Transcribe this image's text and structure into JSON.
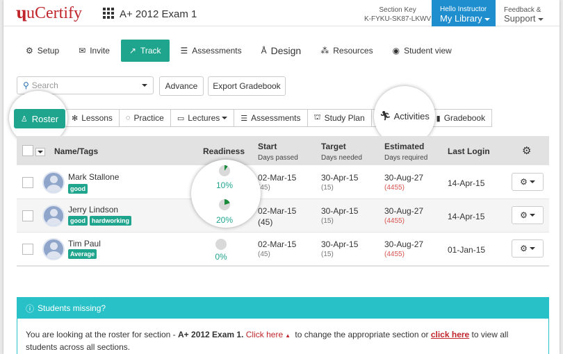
{
  "header": {
    "logo_mark": "ɥ",
    "logo_text": "uCertify",
    "course_title": "A+ 2012 Exam 1",
    "section_key_label": "Section Key",
    "section_key_value": "K-FYKU-SK87-LKWV",
    "hello_label": "Hello Instructor",
    "library_label": "My Library",
    "feedback_label": "Feedback &",
    "support_label": "Support",
    "accent_color": "#1f8ece"
  },
  "nav": {
    "setup": "Setup",
    "invite": "Invite",
    "track": "Track",
    "assessments": "Assessments",
    "design": "Design",
    "resources": "Resources",
    "student_view": "Student view",
    "active_color": "#1fa58e"
  },
  "toolbar": {
    "search_placeholder": "Search",
    "advance": "Advance",
    "export": "Export Gradebook"
  },
  "subtabs": {
    "roster": "Roster",
    "lessons": "Lessons",
    "practice": "Practice",
    "lectures": "Lectures",
    "assessments": "Assessments",
    "study_plan": "Study Plan",
    "activities": "Activities",
    "gradebook": "Gradebook"
  },
  "table": {
    "headers": {
      "name": "Name/Tags",
      "readiness": "Readiness",
      "start": "Start",
      "start_sub": "Days passed",
      "target": "Target",
      "target_sub": "Days needed",
      "estimated": "Estimated",
      "estimated_sub": "Days required",
      "last_login": "Last Login"
    },
    "rows": [
      {
        "name": "Mark Stallone",
        "tags": [
          "good"
        ],
        "readiness": "10%",
        "readiness_value": 0.1,
        "start": "02-Mar-15",
        "start_days": "(45)",
        "target": "30-Apr-15",
        "target_days": "(15)",
        "estimated": "30-Aug-27",
        "estimated_days": "(4455)",
        "last_login": "14-Apr-15"
      },
      {
        "name": "Jerry Lindson",
        "tags": [
          "good",
          "hardworking"
        ],
        "readiness": "20%",
        "readiness_value": 0.2,
        "start": "02-Mar-15",
        "start_days": "(45)",
        "target": "30-Apr-15",
        "target_days": "(15)",
        "estimated": "30-Aug-27",
        "estimated_days": "(4455)",
        "last_login": "14-Apr-15"
      },
      {
        "name": "Tim Paul",
        "tags": [
          "Average"
        ],
        "readiness": "0%",
        "readiness_value": 0.0,
        "start": "02-Mar-15",
        "start_days": "(45)",
        "target": "30-Apr-15",
        "target_days": "(15)",
        "estimated": "30-Aug-27",
        "estimated_days": "(4455)",
        "last_login": "01-Jan-15"
      }
    ]
  },
  "missing": {
    "title": "Students missing?",
    "text_1": "You are looking at the roster for section - ",
    "section": "A+ 2012 Exam 1.",
    "link_1": "Click here",
    "text_2": " to change the appropriate section or ",
    "link_2": "click here",
    "text_3": " to view all students across all sections."
  }
}
